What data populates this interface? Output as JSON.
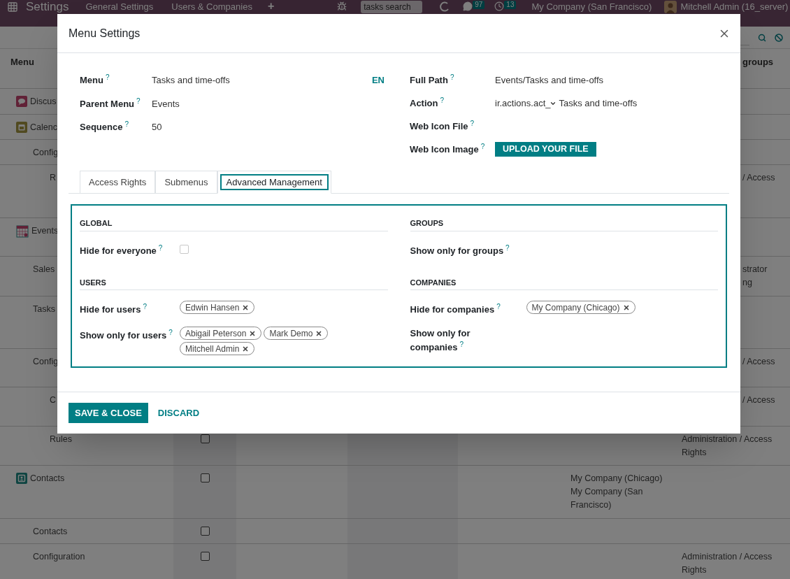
{
  "navbar": {
    "app_name": "Settings",
    "menus": [
      "General Settings",
      "Users & Companies"
    ],
    "new_item": "+",
    "search": {
      "placeholder": "tasks search"
    },
    "messages_count": "97",
    "activities_count": "13",
    "company": "My Company (San Francisco)",
    "user": "Mitchell Admin (16_server)"
  },
  "list": {
    "columns": [
      "Menu",
      "groups"
    ],
    "rows": [
      {
        "kind": "chat",
        "name": "Discus"
      },
      {
        "kind": "calendar",
        "name": "Calenc",
        "children": [
          {
            "name": "Config",
            "children": [
              {
                "name": "R",
                "groups": [
                  "/ Access"
                ]
              }
            ]
          }
        ]
      },
      {
        "kind": "events",
        "name": "Events",
        "children": [
          {
            "name": "Sales",
            "groups": [
              "strator",
              "ng"
            ]
          },
          {
            "name": "Tasks"
          },
          {
            "name": "Config",
            "groups": [
              "/ Access"
            ],
            "children": [
              {
                "name": "C",
                "groups": [
                  "/ Access"
                ]
              },
              {
                "name": "Rules",
                "checked": false,
                "groups": [
                  "Administration / Access Rights"
                ]
              }
            ]
          }
        ]
      },
      {
        "kind": "contacts",
        "name": "Contacts",
        "checked": false,
        "companies": [
          "My Company (Chicago)",
          "My Company (San Francisco)"
        ],
        "children": [
          {
            "name": "Contacts",
            "checked": false
          },
          {
            "name": "Configuration",
            "checked": false,
            "groups": [
              "Administration / Access Rights"
            ]
          }
        ]
      }
    ]
  },
  "dialog": {
    "title": "Menu Settings",
    "fields_left": [
      {
        "label": "Menu",
        "help": "?",
        "value": "Tasks and time-offs",
        "lang": "EN"
      },
      {
        "label": "Parent Menu",
        "help": "?",
        "value": "Events"
      },
      {
        "label": "Sequence",
        "help": "?",
        "value": "50"
      }
    ],
    "fields_right": [
      {
        "kind": "text",
        "label": "Full Path",
        "help": "?",
        "value": "Events/Tasks and time-offs"
      },
      {
        "kind": "reference",
        "label": "Action",
        "help": "?",
        "model": "ir.actions.act_",
        "value": "Tasks and time-offs"
      },
      {
        "kind": "text",
        "label": "Web Icon File",
        "help": "?"
      },
      {
        "kind": "upload",
        "label": "Web Icon Image",
        "help": "?",
        "button": "UPLOAD YOUR FILE"
      }
    ],
    "tabs": [
      {
        "label": "Access Rights",
        "selected": false
      },
      {
        "label": "Submenus",
        "selected": false
      },
      {
        "label": "Advanced Management",
        "selected": true
      }
    ],
    "sections": [
      {
        "heading": "GLOBAL",
        "fields": [
          {
            "kind": "checkbox",
            "label": "Hide for everyone",
            "help": "?",
            "checked": false
          }
        ]
      },
      {
        "heading": "GROUPS",
        "fields": [
          {
            "kind": "tags",
            "label": "Show only for groups",
            "help": "?"
          }
        ]
      },
      {
        "heading": "USERS",
        "fields": [
          {
            "kind": "tags",
            "label": "Hide for users",
            "help": "?",
            "tags": [
              "Edwin Hansen"
            ]
          },
          {
            "kind": "tags",
            "label": "Show only for users",
            "help": "?",
            "tags": [
              "Abigail Peterson",
              "Mark Demo",
              "Mitchell Admin"
            ]
          }
        ]
      },
      {
        "heading": "COMPANIES",
        "fields": [
          {
            "kind": "tags",
            "label": "Hide for companies",
            "help": "?",
            "tags": [
              "My Company (Chicago)"
            ]
          },
          {
            "kind": "tags",
            "label": "Show only for companies",
            "help": "?"
          }
        ]
      }
    ],
    "buttons": [
      "SAVE & CLOSE",
      "DISCARD"
    ]
  }
}
